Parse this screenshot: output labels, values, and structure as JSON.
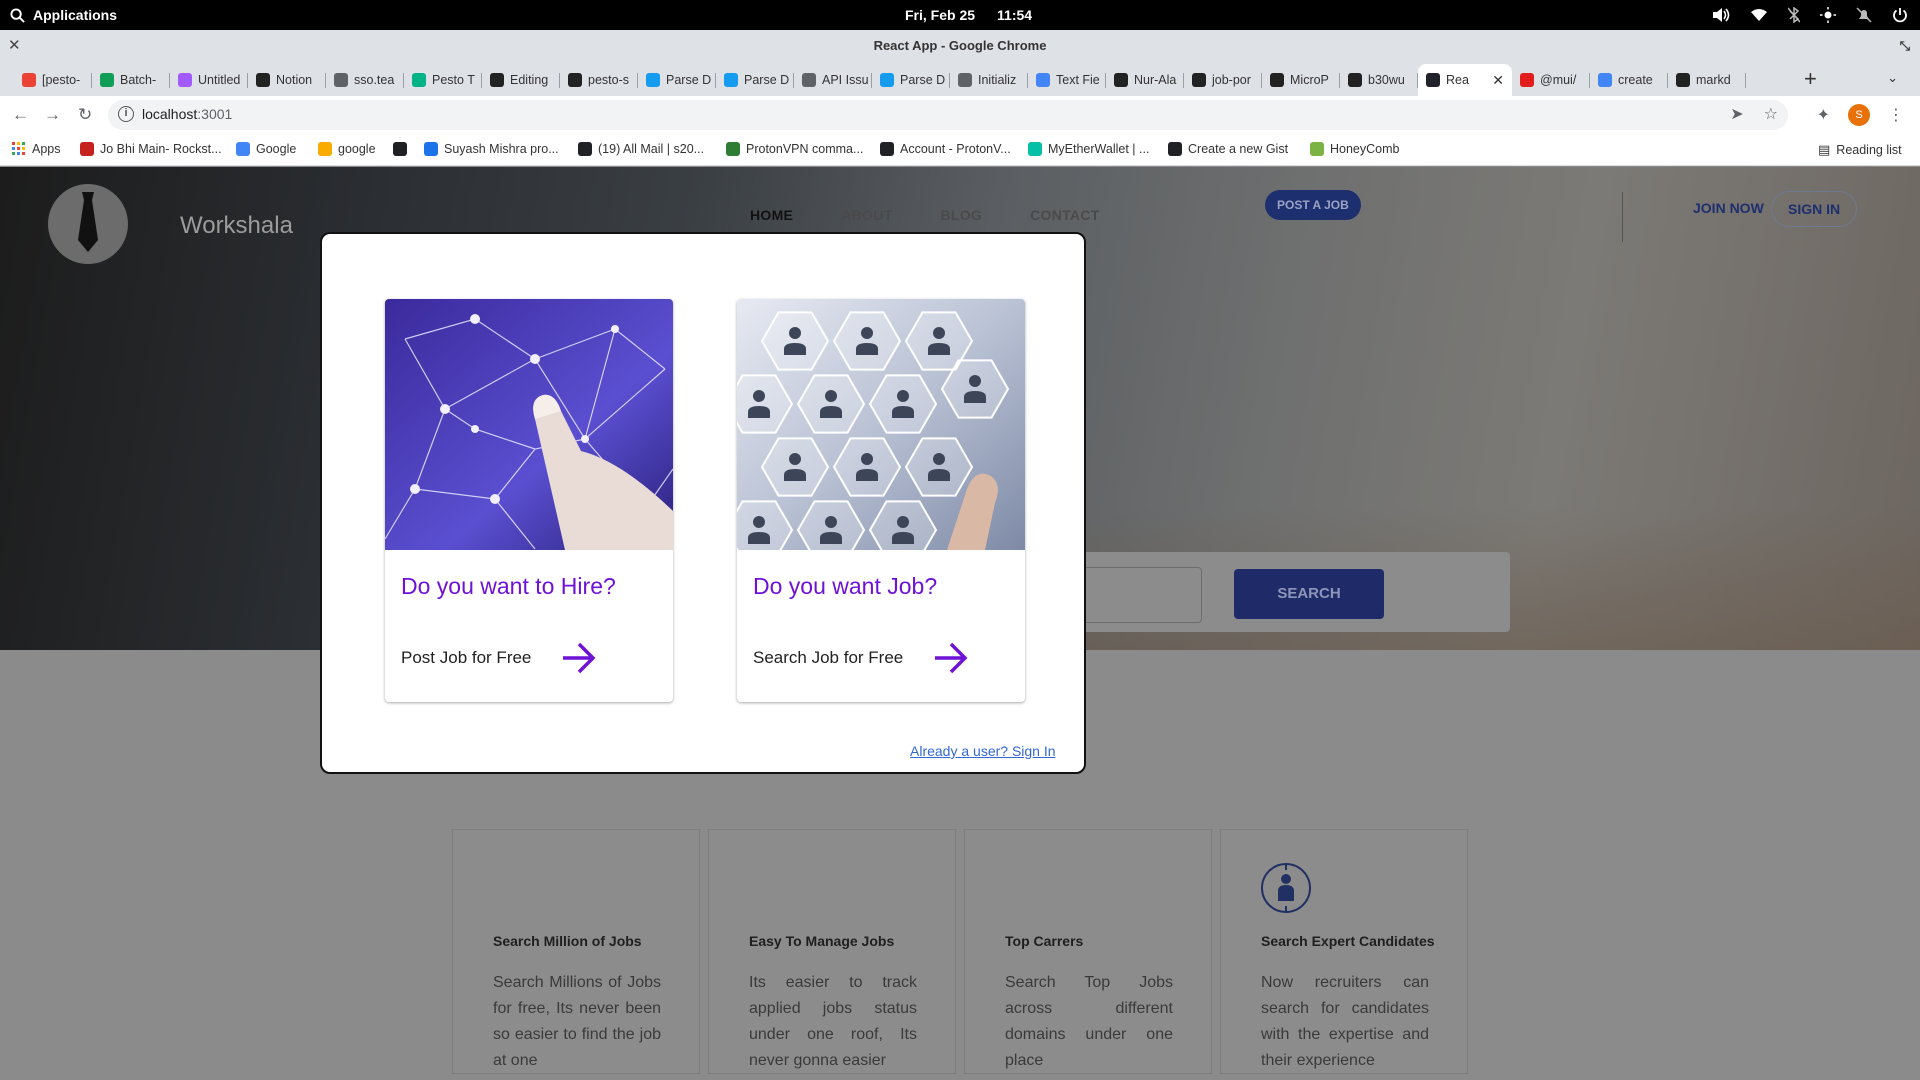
{
  "os": {
    "apps_label": "Applications",
    "date": "Fri, Feb 25",
    "time": "11:54"
  },
  "window": {
    "title": "React App - Google Chrome"
  },
  "tabs": [
    {
      "label": "[pesto-",
      "color": "#ea4335"
    },
    {
      "label": "Batch-",
      "color": "#0f9d58"
    },
    {
      "label": "Untitled",
      "color": "#a259ff"
    },
    {
      "label": "Notion",
      "color": "#222222"
    },
    {
      "label": "sso.tea",
      "color": "#5f6368"
    },
    {
      "label": "Pesto T",
      "color": "#00b386"
    },
    {
      "label": "Editing",
      "color": "#222222"
    },
    {
      "label": "pesto-s",
      "color": "#222222"
    },
    {
      "label": "Parse D",
      "color": "#169cee"
    },
    {
      "label": "Parse D",
      "color": "#169cee"
    },
    {
      "label": "API Issu",
      "color": "#5f6368"
    },
    {
      "label": "Parse D",
      "color": "#169cee"
    },
    {
      "label": "Initializ",
      "color": "#5f6368"
    },
    {
      "label": "Text Fie",
      "color": "#4285f4"
    },
    {
      "label": "Nur-Ala",
      "color": "#222222"
    },
    {
      "label": "job-por",
      "color": "#222222"
    },
    {
      "label": "MicroP",
      "color": "#222222"
    },
    {
      "label": "b30wu",
      "color": "#222222"
    },
    {
      "label": "Rea",
      "color": "#20232a",
      "active": true
    },
    {
      "label": "@mui/",
      "color": "#e31c1c"
    },
    {
      "label": "create",
      "color": "#4285f4"
    },
    {
      "label": "markd",
      "color": "#222222"
    }
  ],
  "toolbar": {
    "url_host": "localhost",
    "url_port": ":3001"
  },
  "bookmarks": [
    {
      "label": "Apps",
      "color": "#ea4335"
    },
    {
      "label": "Jo Bhi Main- Rockst...",
      "color": "#c5221f"
    },
    {
      "label": "Google",
      "color": "#4285f4"
    },
    {
      "label": "google",
      "color": "#f9ab00"
    },
    {
      "label": "",
      "color": "#202124"
    },
    {
      "label": "Suyash Mishra pro...",
      "color": "#1a73e8"
    },
    {
      "label": "(19) All Mail | s20...",
      "color": "#202124"
    },
    {
      "label": "ProtonVPN comma...",
      "color": "#2e7d32"
    },
    {
      "label": "Account - ProtonV...",
      "color": "#202124"
    },
    {
      "label": "MyEtherWallet | ...",
      "color": "#05c0a5"
    },
    {
      "label": "Create a new Gist",
      "color": "#202124"
    },
    {
      "label": "HoneyComb",
      "color": "#7cb342"
    }
  ],
  "reading_list": "Reading list",
  "site": {
    "brand": "Workshala",
    "nav": [
      "HOME",
      "ABOUT",
      "BLOG",
      "CONTACT"
    ],
    "post_job": "POST A JOB",
    "join_now": "JOIN NOW",
    "sign_in": "SIGN IN",
    "search_button": "SEARCH",
    "features": [
      {
        "title": "Search Million of Jobs",
        "body": "Search Millions of Jobs for free, Its never been so easier to find the job at one"
      },
      {
        "title": "Easy To Manage Jobs",
        "body": "Its easier to track applied jobs status under one roof, Its never gonna easier"
      },
      {
        "title": "Top Carrers",
        "body": "Search Top Jobs across different domains under one place"
      },
      {
        "title": "Search Expert Candidates",
        "body": "Now recruiters can search for candidates with the expertise and their experience"
      }
    ]
  },
  "modal": {
    "hire": {
      "title": "Do you want to Hire?",
      "action": "Post Job for Free"
    },
    "job": {
      "title": "Do you want Job?",
      "action": "Search Job for Free"
    },
    "signin_link": "Already a user? Sign In",
    "accent": "#6d12d6"
  }
}
